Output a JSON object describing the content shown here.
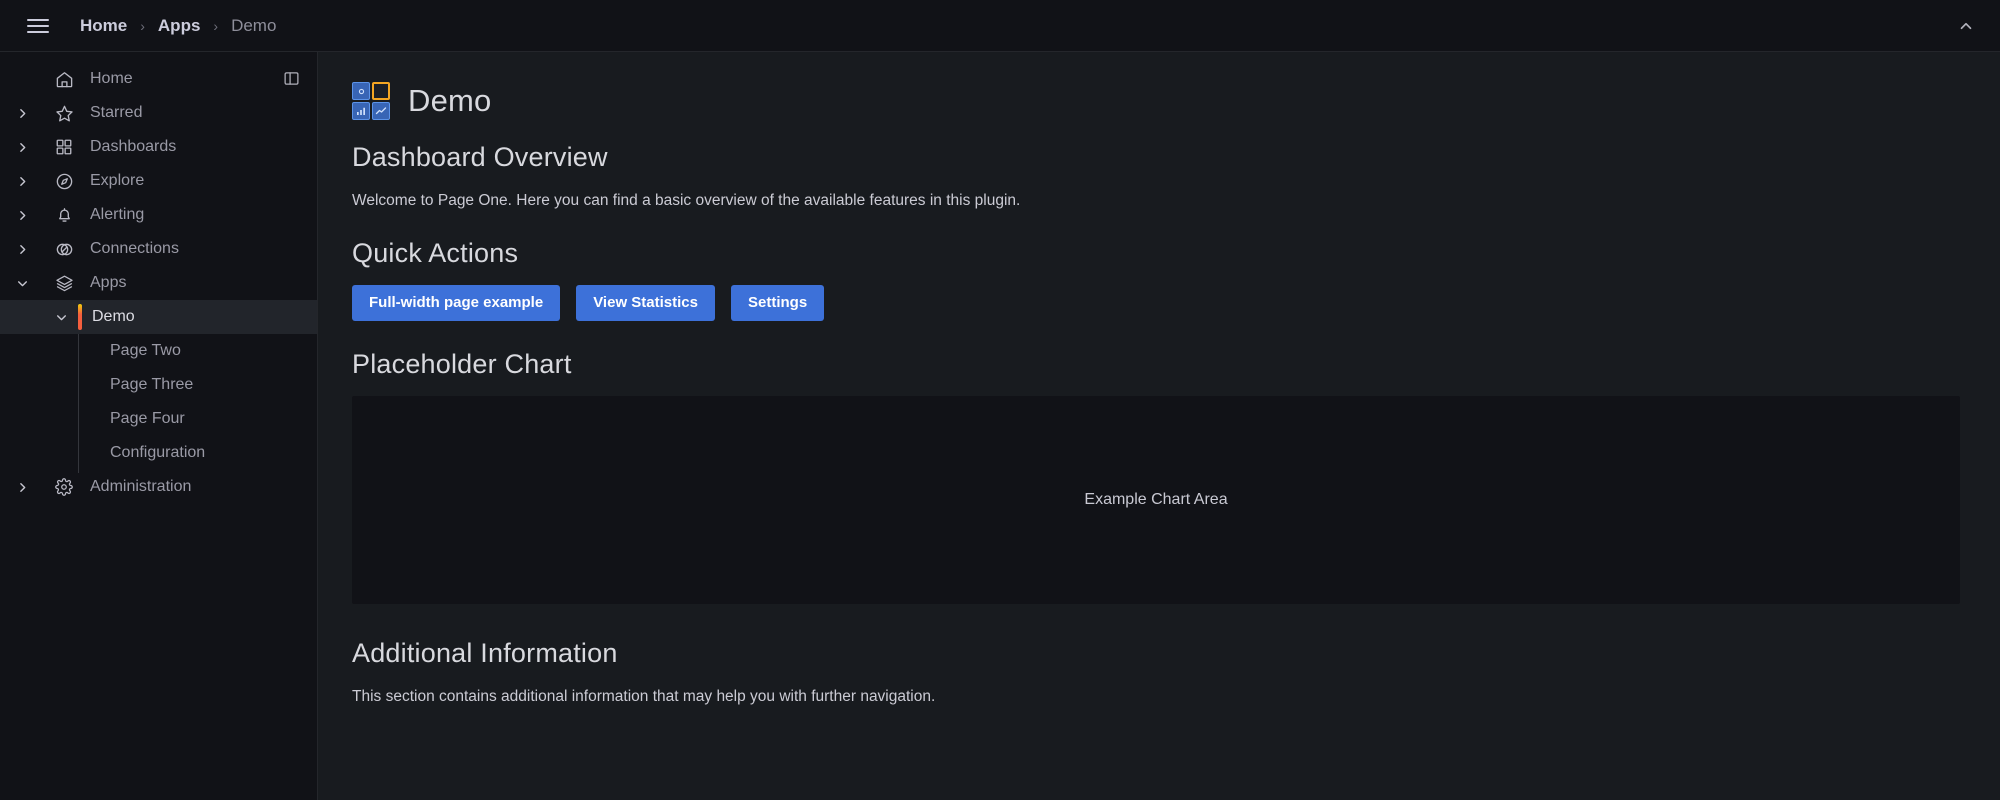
{
  "topbar": {
    "menu_icon": "hamburger-menu-icon",
    "collapse_icon": "chevron-up-icon",
    "breadcrumbs": [
      {
        "label": "Home",
        "current": false
      },
      {
        "label": "Apps",
        "current": false
      },
      {
        "label": "Demo",
        "current": true
      }
    ],
    "separator": "›"
  },
  "sidebar": {
    "dock_toggle_icon": "dock-panel-icon",
    "items": [
      {
        "label": "Home",
        "icon": "home-icon",
        "level": 1,
        "expandable": false,
        "expanded": false,
        "active": false
      },
      {
        "label": "Starred",
        "icon": "star-icon",
        "level": 1,
        "expandable": true,
        "expanded": false,
        "active": false
      },
      {
        "label": "Dashboards",
        "icon": "dashboards-grid-icon",
        "level": 1,
        "expandable": true,
        "expanded": false,
        "active": false
      },
      {
        "label": "Explore",
        "icon": "compass-icon",
        "level": 1,
        "expandable": true,
        "expanded": false,
        "active": false
      },
      {
        "label": "Alerting",
        "icon": "bell-icon",
        "level": 1,
        "expandable": true,
        "expanded": false,
        "active": false
      },
      {
        "label": "Connections",
        "icon": "connections-icon",
        "level": 1,
        "expandable": true,
        "expanded": false,
        "active": false
      },
      {
        "label": "Apps",
        "icon": "layers-icon",
        "level": 1,
        "expandable": true,
        "expanded": true,
        "active": false
      },
      {
        "label": "Demo",
        "icon": null,
        "level": 1,
        "expandable": true,
        "expanded": true,
        "active": true,
        "indent": "sub"
      },
      {
        "label": "Page Two",
        "icon": null,
        "level": 2,
        "expandable": false,
        "expanded": false,
        "active": false
      },
      {
        "label": "Page Three",
        "icon": null,
        "level": 2,
        "expandable": false,
        "expanded": false,
        "active": false
      },
      {
        "label": "Page Four",
        "icon": null,
        "level": 2,
        "expandable": false,
        "expanded": false,
        "active": false
      },
      {
        "label": "Configuration",
        "icon": null,
        "level": 2,
        "expandable": false,
        "expanded": false,
        "active": false
      },
      {
        "label": "Administration",
        "icon": "gear-icon",
        "level": 1,
        "expandable": true,
        "expanded": false,
        "active": false
      }
    ]
  },
  "main": {
    "app_title": "Demo",
    "app_logo_icon": "demo-app-panels-logo",
    "overview_heading": "Dashboard Overview",
    "overview_text": "Welcome to Page One. Here you can find a basic overview of the available features in this plugin.",
    "quick_actions_heading": "Quick Actions",
    "buttons": [
      {
        "label": "Full-width page example"
      },
      {
        "label": "View Statistics"
      },
      {
        "label": "Settings"
      }
    ],
    "chart_heading": "Placeholder Chart",
    "chart_placeholder_label": "Example Chart Area",
    "additional_heading": "Additional Information",
    "additional_text": "This section contains additional information that may help you with further navigation."
  },
  "colors": {
    "page_bg": "#181b1f",
    "chrome_bg": "#111217",
    "border": "#24262b",
    "primary_blue": "#3d71d9",
    "active_indicator_orange": "#f55f3e",
    "logo_orange": "#f5a623",
    "logo_blue": "#3865b5",
    "text_primary": "#d8d9de",
    "text_secondary": "#9a9aa6"
  }
}
